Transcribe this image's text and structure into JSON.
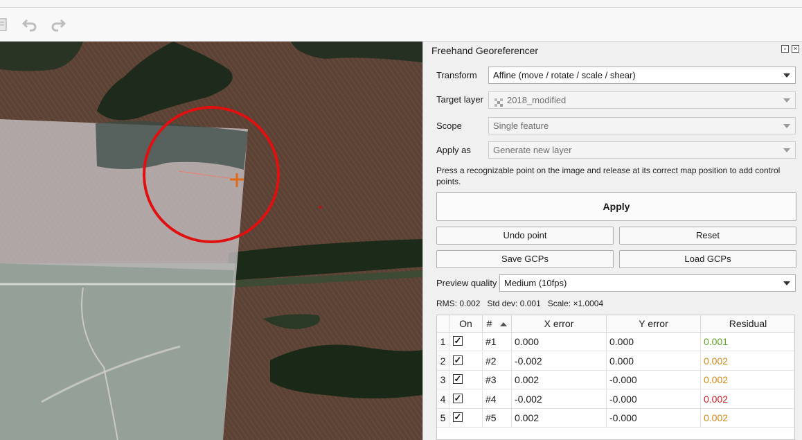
{
  "toolbar": {
    "icons": [
      "clipboard-icon",
      "undo-icon",
      "redo-icon"
    ]
  },
  "panel": {
    "title": "Freehand Georeferencer",
    "transform_label": "Transform",
    "transform_value": "Affine (move / rotate / scale / shear)",
    "target_label": "Target layer",
    "target_value": "2018_modified",
    "scope_label": "Scope",
    "scope_value": "Single feature",
    "apply_as_label": "Apply as",
    "apply_as_value": "Generate new layer",
    "help_text": "Press a recognizable point on the image and release at its correct map position to add control points.",
    "apply_label": "Apply",
    "undo_label": "Undo point",
    "reset_label": "Reset",
    "save_label": "Save GCPs",
    "load_label": "Load GCPs",
    "preview_label": "Preview quality",
    "preview_value": "Medium (10fps)",
    "stats": "RMS: 0.002   Std dev: 0.001   Scale: ×1.0004"
  },
  "table": {
    "headers": {
      "on": "On",
      "num": "#",
      "x": "X error",
      "y": "Y error",
      "res": "Residual"
    },
    "rows": [
      {
        "n": "1",
        "id": "#1",
        "x": "0.000",
        "y": "0.000",
        "res": "0.001",
        "color": "#5aa51e"
      },
      {
        "n": "2",
        "id": "#2",
        "x": "-0.002",
        "y": "0.000",
        "res": "0.002",
        "color": "#d48a12"
      },
      {
        "n": "3",
        "id": "#3",
        "x": "0.002",
        "y": "-0.000",
        "res": "0.002",
        "color": "#d48a12"
      },
      {
        "n": "4",
        "id": "#4",
        "x": "-0.002",
        "y": "-0.000",
        "res": "0.002",
        "color": "#cc1e1e"
      },
      {
        "n": "5",
        "id": "#5",
        "x": "0.002",
        "y": "-0.000",
        "res": "0.002",
        "color": "#d48a12"
      }
    ]
  }
}
